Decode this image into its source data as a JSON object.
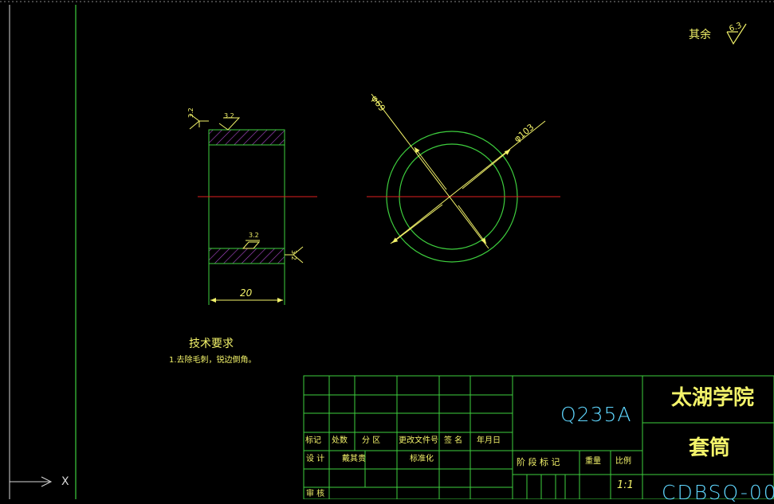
{
  "roughness_note": {
    "label": "其余",
    "value": "6.3"
  },
  "dimensions": {
    "width": "20",
    "inner_diameter": "φ69",
    "outer_diameter": "φ103",
    "roughness_top_left": "3.2",
    "roughness_top": "3.2",
    "roughness_bottom": "3.2",
    "roughness_bottom_right": "3.2"
  },
  "tech_requirements": {
    "title": "技术要求",
    "line1": "1.去除毛刺，锐边倒角。"
  },
  "title_block": {
    "material": "Q235A",
    "school": "太湖学院",
    "part_name": "套筒",
    "drawing_no": "CDBSQ-00",
    "scale": "1:1",
    "headers": {
      "mark": "标记",
      "count": "处数",
      "zone": "分 区",
      "change_doc": "更改文件号",
      "sign": "签 名",
      "date": "年月日",
      "design": "设 计",
      "designer": "戴其贵",
      "standardize": "标准化",
      "stage_mark": "阶 段 标 记",
      "weight": "重量",
      "scale_label": "比例",
      "review": "审 核"
    }
  },
  "ucs": {
    "x_label": "X"
  }
}
